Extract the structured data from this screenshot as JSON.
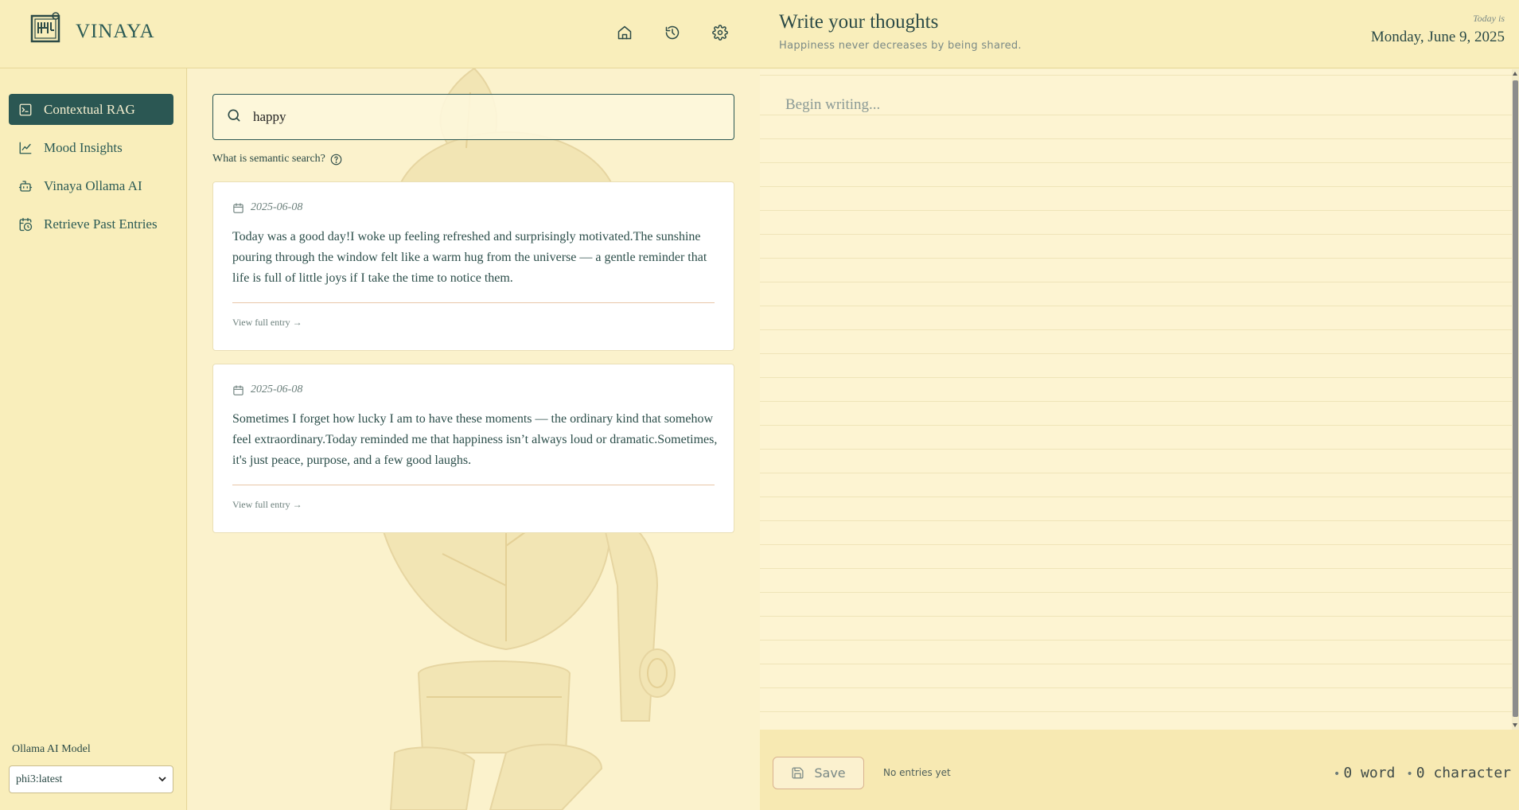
{
  "app": {
    "brand": "VINAYA"
  },
  "header": {
    "nav": [
      {
        "icon": "home-icon"
      },
      {
        "icon": "history-icon"
      },
      {
        "icon": "gear-icon"
      }
    ]
  },
  "sidebar": {
    "items": [
      {
        "label": "Contextual RAG",
        "icon": "terminal-icon",
        "active": true
      },
      {
        "label": "Mood Insights",
        "icon": "chart-line-icon",
        "active": false
      },
      {
        "label": "Vinaya Ollama AI",
        "icon": "bot-icon",
        "active": false
      },
      {
        "label": "Retrieve Past Entries",
        "icon": "calendar-clock-icon",
        "active": false
      }
    ],
    "model_label": "Ollama AI Model",
    "model_value": "phi3:latest"
  },
  "search": {
    "value": "happy",
    "help_text": "What is semantic search?"
  },
  "results": [
    {
      "date": "2025-06-08",
      "text": "Today was a good day!I woke up feeling refreshed and surprisingly motivated.The sunshine pouring through the window felt like a warm hug from the universe — a gentle reminder that life is full of little joys if I take the time to notice them.",
      "link": "View full entry →"
    },
    {
      "date": "2025-06-08",
      "text": "Sometimes I forget how lucky I am to have these moments — the ordinary kind that somehow feel extraordinary.Today reminded me that happiness isn’t always loud or dramatic.Sometimes, it's just peace, purpose, and a few good laughs.",
      "link": "View full entry →"
    }
  ],
  "writer": {
    "title": "Write your thoughts",
    "subtitle": "Happiness never decreases by being shared.",
    "today_label": "Today is",
    "today_date": "Monday, June 9, 2025",
    "placeholder": "Begin writing...",
    "save_label": "Save",
    "entries_status": "No entries yet",
    "word_count": "0 word",
    "char_count": "0 character"
  },
  "colors": {
    "accent": "#2b5753",
    "background": "#faf1c6"
  }
}
